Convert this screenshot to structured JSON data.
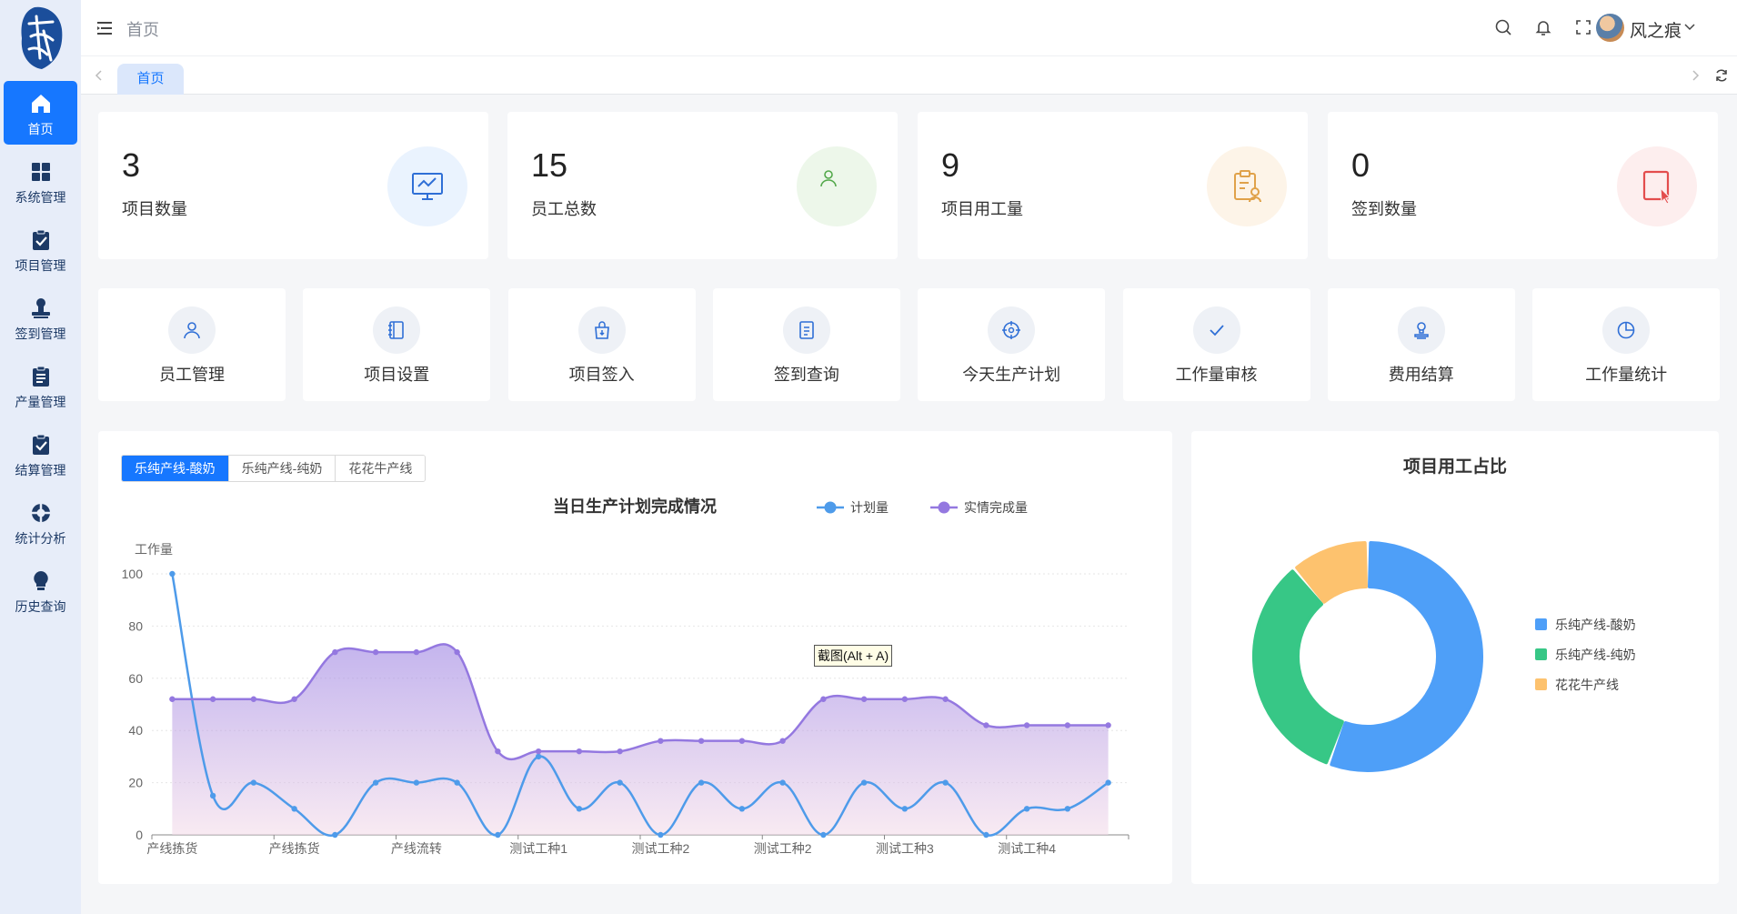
{
  "sidebar": {
    "items": [
      {
        "label": "首页",
        "icon": "home-icon"
      },
      {
        "label": "系统管理",
        "icon": "grid-icon"
      },
      {
        "label": "项目管理",
        "icon": "clipboard-check-icon"
      },
      {
        "label": "签到管理",
        "icon": "stamp-icon"
      },
      {
        "label": "产量管理",
        "icon": "clipboard-list-icon"
      },
      {
        "label": "结算管理",
        "icon": "clipboard-check-icon"
      },
      {
        "label": "统计分析",
        "icon": "lifebuoy-icon"
      },
      {
        "label": "历史查询",
        "icon": "bulb-icon"
      }
    ]
  },
  "header": {
    "title": "首页",
    "user": "风之痕"
  },
  "tabs": [
    {
      "label": "首页"
    }
  ],
  "stats": [
    {
      "value": "3",
      "label": "项目数量",
      "icon": "monitor-icon",
      "color": "#2f6fd6",
      "bg": "#eaf3fe"
    },
    {
      "value": "15",
      "label": "员工总数",
      "icon": "user-icon",
      "color": "#52a84a",
      "bg": "#edf7ea"
    },
    {
      "value": "9",
      "label": "项目用工量",
      "icon": "clipboard-user-icon",
      "color": "#e0a24a",
      "bg": "#fdf4e8"
    },
    {
      "value": "0",
      "label": "签到数量",
      "icon": "tablet-cursor-icon",
      "color": "#e34d4d",
      "bg": "#fdeeee"
    }
  ],
  "quick": [
    {
      "label": "员工管理",
      "icon": "user-icon"
    },
    {
      "label": "项目设置",
      "icon": "notebook-icon"
    },
    {
      "label": "项目签入",
      "icon": "bag-icon"
    },
    {
      "label": "签到查询",
      "icon": "document-icon"
    },
    {
      "label": "今天生产计划",
      "icon": "target-icon"
    },
    {
      "label": "工作量审核",
      "icon": "check-icon"
    },
    {
      "label": "费用结算",
      "icon": "stamp-icon"
    },
    {
      "label": "工作量统计",
      "icon": "pie-icon"
    }
  ],
  "tabs_lines": [
    "乐纯产线-酸奶",
    "乐纯产线-纯奶",
    "花花牛产线"
  ],
  "tooltip_text": "截图(Alt + A)",
  "colors": {
    "primary": "#1677ff",
    "plan": "#4e9bea",
    "actual": "#9478e0",
    "pie1": "#4e9ff8",
    "pie2": "#37c786",
    "pie3": "#fdc26e"
  },
  "chart_data": [
    {
      "type": "line",
      "title": "当日生产计划完成情况",
      "ylabel": "工作量",
      "ylim": [
        0,
        100
      ],
      "yticks": [
        0,
        20,
        40,
        60,
        80,
        100
      ],
      "tick_labels": [
        "产线拣货",
        "产线拣货",
        "产线流转",
        "测试工种1",
        "测试工种2",
        "测试工种2",
        "测试工种3",
        "测试工种4"
      ],
      "legend_position": "top-right",
      "x_count": 24,
      "series": [
        {
          "name": "计划量",
          "values": [
            100,
            15,
            20,
            10,
            0,
            20,
            20,
            20,
            0,
            30,
            10,
            20,
            0,
            20,
            10,
            20,
            0,
            20,
            10,
            20,
            0,
            10,
            10,
            20
          ]
        },
        {
          "name": "实情完成量",
          "values": [
            52,
            52,
            52,
            52,
            70,
            70,
            70,
            70,
            32,
            32,
            32,
            32,
            36,
            36,
            36,
            36,
            52,
            52,
            52,
            52,
            42,
            42,
            42,
            42
          ]
        }
      ]
    },
    {
      "type": "pie",
      "title": "项目用工占比",
      "legend_position": "right",
      "categories": [
        "乐纯产线-酸奶",
        "乐纯产线-纯奶",
        "花花牛产线"
      ],
      "values": [
        5,
        3,
        1
      ]
    }
  ]
}
